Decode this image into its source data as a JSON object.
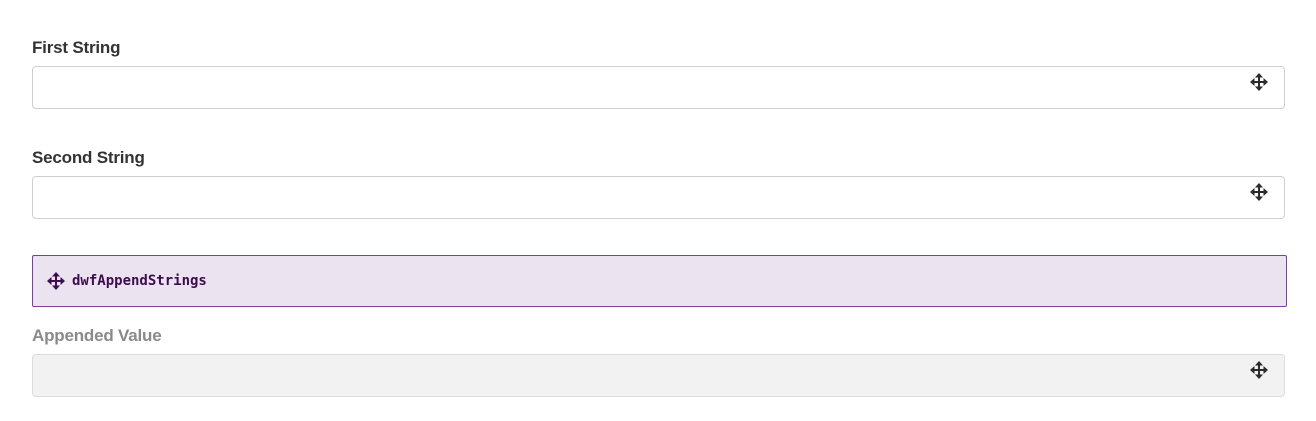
{
  "form": {
    "first_string": {
      "label": "First String",
      "value": ""
    },
    "second_string": {
      "label": "Second String",
      "value": ""
    },
    "function_block": {
      "name": "dwfAppendStrings"
    },
    "appended_value": {
      "label": "Appended Value",
      "value": ""
    }
  },
  "icons": {
    "drag": "move-icon"
  },
  "colors": {
    "label_text": "#333333",
    "label_disabled": "#8a8a8a",
    "function_bg": "#ebe3f0",
    "function_border": "#7b3fa0",
    "function_text": "#3d0d4f",
    "disabled_field_bg": "#f2f2f2"
  }
}
